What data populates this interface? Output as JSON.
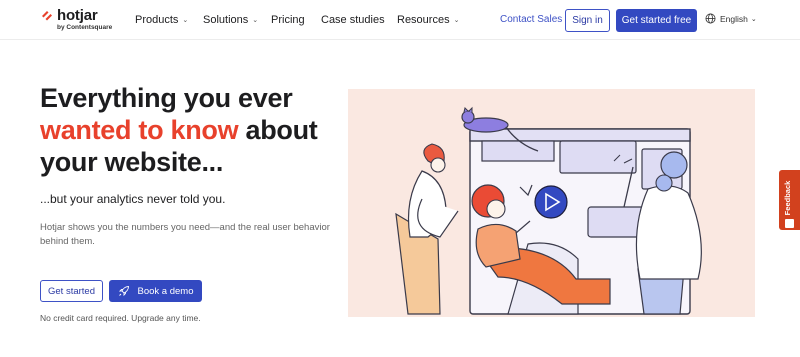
{
  "brand": {
    "name": "hotjar",
    "tagline": "by Contentsquare",
    "accent_color": "#e8412c",
    "primary_color": "#3349c1"
  },
  "nav": {
    "items": [
      {
        "label": "Products",
        "has_dropdown": true
      },
      {
        "label": "Solutions",
        "has_dropdown": true
      },
      {
        "label": "Pricing",
        "has_dropdown": false
      },
      {
        "label": "Case studies",
        "has_dropdown": false
      },
      {
        "label": "Resources",
        "has_dropdown": true
      }
    ],
    "contact_sales": "Contact Sales",
    "sign_in": "Sign in",
    "get_started": "Get started free",
    "language": "English",
    "globe_icon": "globe-icon"
  },
  "hero": {
    "headline_part1": "Everything you ever",
    "headline_accent": "wanted to know",
    "headline_part2": "about your website...",
    "subheadline": "...but your analytics never told you.",
    "description": "Hotjar shows you the numbers you need—and the real user behavior behind them.",
    "primary_cta": "Get started",
    "secondary_cta": "Book a demo",
    "secondary_cta_icon": "rocket-icon",
    "note": "No credit card required. Upgrade any time."
  },
  "illustration": {
    "background": "#fae8e1",
    "play_icon": "play-icon"
  },
  "feedback_tab": {
    "label": "Feedback",
    "color": "#d2411e"
  }
}
